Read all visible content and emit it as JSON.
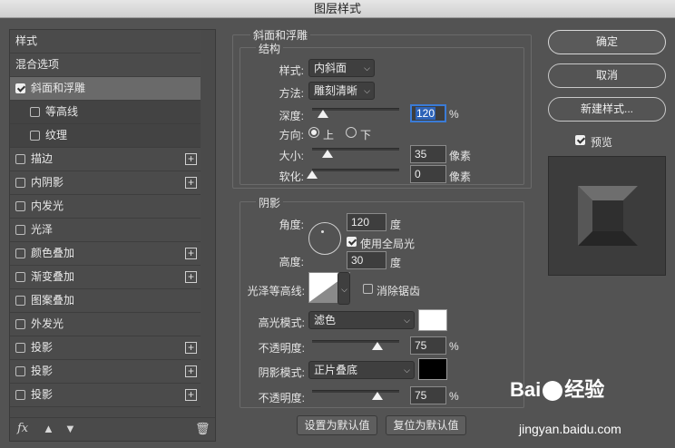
{
  "window": {
    "title": "图层样式"
  },
  "left_panel": {
    "items": [
      {
        "label": "样式",
        "checkbox": null,
        "plus": false,
        "indent": 0,
        "selected": false
      },
      {
        "label": "混合选项",
        "checkbox": null,
        "plus": false,
        "indent": 0,
        "selected": false
      },
      {
        "label": "斜面和浮雕",
        "checkbox": true,
        "plus": false,
        "indent": 0,
        "selected": true
      },
      {
        "label": "等高线",
        "checkbox": false,
        "plus": false,
        "indent": 1,
        "selected": false
      },
      {
        "label": "纹理",
        "checkbox": false,
        "plus": false,
        "indent": 1,
        "selected": false
      },
      {
        "label": "描边",
        "checkbox": false,
        "plus": true,
        "indent": 0,
        "selected": false
      },
      {
        "label": "内阴影",
        "checkbox": false,
        "plus": true,
        "indent": 0,
        "selected": false
      },
      {
        "label": "内发光",
        "checkbox": false,
        "plus": false,
        "indent": 0,
        "selected": false
      },
      {
        "label": "光泽",
        "checkbox": false,
        "plus": false,
        "indent": 0,
        "selected": false
      },
      {
        "label": "颜色叠加",
        "checkbox": false,
        "plus": true,
        "indent": 0,
        "selected": false
      },
      {
        "label": "渐变叠加",
        "checkbox": false,
        "plus": true,
        "indent": 0,
        "selected": false
      },
      {
        "label": "图案叠加",
        "checkbox": false,
        "plus": false,
        "indent": 0,
        "selected": false
      },
      {
        "label": "外发光",
        "checkbox": false,
        "plus": false,
        "indent": 0,
        "selected": false
      },
      {
        "label": "投影",
        "checkbox": false,
        "plus": true,
        "indent": 0,
        "selected": false
      },
      {
        "label": "投影",
        "checkbox": false,
        "plus": true,
        "indent": 0,
        "selected": false
      },
      {
        "label": "投影",
        "checkbox": false,
        "plus": true,
        "indent": 0,
        "selected": false
      }
    ],
    "footer": {
      "fx_label": "fx",
      "icons": [
        "fx-icon",
        "move-up-icon",
        "move-down-icon",
        "trash-icon"
      ]
    }
  },
  "bevel": {
    "section_title": "斜面和浮雕",
    "structure_title": "结构",
    "style_label": "样式:",
    "style_value": "内斜面",
    "technique_label": "方法:",
    "technique_value": "雕刻清晰",
    "depth_label": "深度:",
    "depth_value": "120",
    "depth_unit": "%",
    "depth_slider_level": 0.12,
    "direction_label": "方向:",
    "direction_up": "上",
    "direction_down": "下",
    "direction_selected": "上",
    "size_label": "大小:",
    "size_value": "35",
    "size_unit": "像素",
    "size_slider_level": 0.18,
    "soften_label": "软化:",
    "soften_value": "0",
    "soften_unit": "像素",
    "soften_slider_level": 0.0
  },
  "shading": {
    "title": "阴影",
    "angle_label": "角度:",
    "angle_value": "120",
    "angle_unit": "度",
    "global_light_label": "使用全局光",
    "global_light_checked": true,
    "altitude_label": "高度:",
    "altitude_value": "30",
    "altitude_unit": "度",
    "gloss_contour_label": "光泽等高线:",
    "anti_aliased_label": "消除锯齿",
    "anti_aliased_checked": false,
    "highlight_mode_label": "高光模式:",
    "highlight_mode_value": "滤色",
    "highlight_color": "#ffffff",
    "highlight_opacity_label": "不透明度:",
    "highlight_opacity_value": "75",
    "highlight_opacity_unit": "%",
    "highlight_opacity_level": 0.75,
    "shadow_mode_label": "阴影模式:",
    "shadow_mode_value": "正片叠底",
    "shadow_color": "#000000",
    "shadow_opacity_label": "不透明度:",
    "shadow_opacity_value": "75",
    "shadow_opacity_unit": "%",
    "shadow_opacity_level": 0.75
  },
  "bottom_buttons": {
    "make_default": "设置为默认值",
    "reset_default": "复位为默认值"
  },
  "right_panel": {
    "ok": "确定",
    "cancel": "取消",
    "new_style": "新建样式...",
    "preview_label": "预览",
    "preview_checked": true
  },
  "watermark": {
    "brand": "Bai",
    "brand_tail": "经验",
    "url": "jingyan.baidu.com"
  }
}
